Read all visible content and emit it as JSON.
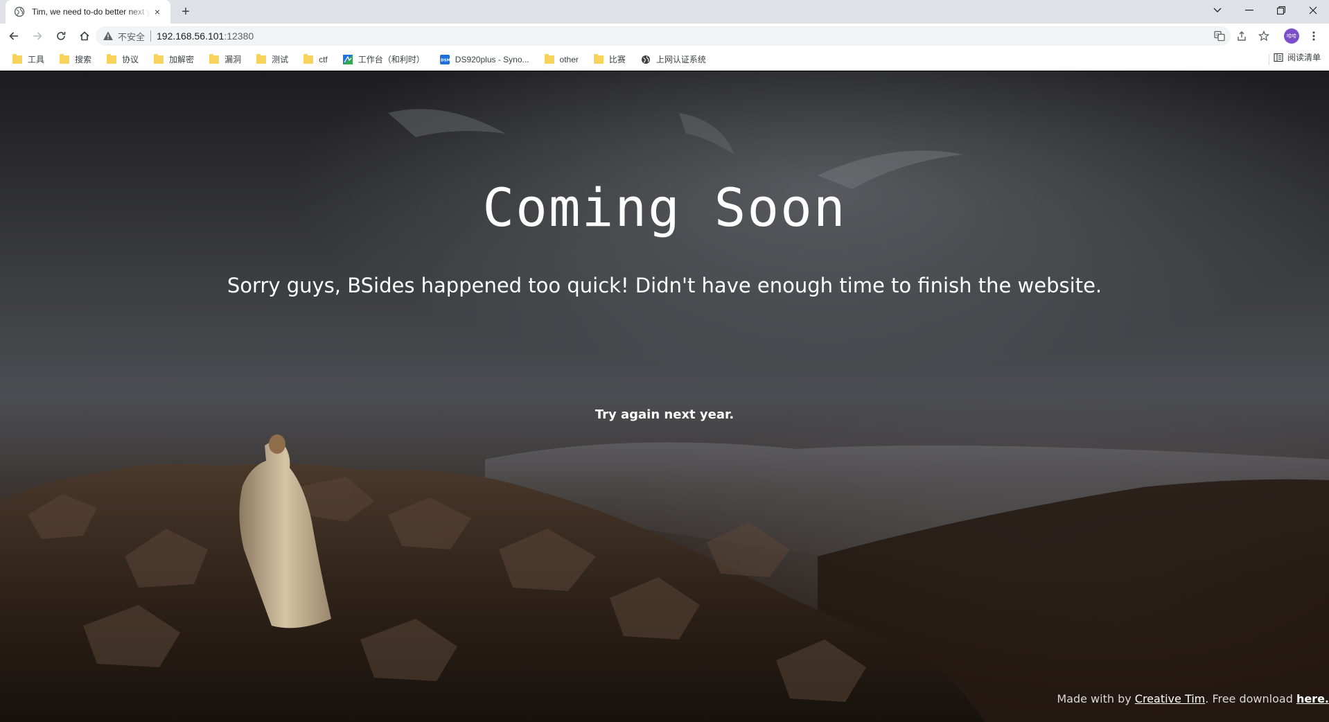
{
  "browser": {
    "tab": {
      "title": "Tim, we need to-do better next year for Initech",
      "close": "×"
    },
    "new_tab": "+",
    "window_controls": {
      "menu": "⌄",
      "minimize": "—",
      "restore": "❐",
      "close": "✕"
    },
    "address": {
      "security_label": "不安全",
      "host": "192.168.56.101",
      "port": ":12380"
    },
    "profile_initials": "哈哈"
  },
  "bookmarks": {
    "items": [
      {
        "label": "工具",
        "icon": "folder-icon"
      },
      {
        "label": "搜索",
        "icon": "folder-icon"
      },
      {
        "label": "协议",
        "icon": "folder-icon"
      },
      {
        "label": "加解密",
        "icon": "folder-icon"
      },
      {
        "label": "漏洞",
        "icon": "folder-icon"
      },
      {
        "label": "测试",
        "icon": "folder-icon"
      },
      {
        "label": "ctf",
        "icon": "folder-icon"
      },
      {
        "label": "工作台（和利时）",
        "icon": "site-icon"
      },
      {
        "label": "DS920plus - Syno...",
        "icon": "dsm-icon"
      },
      {
        "label": "other",
        "icon": "folder-icon"
      },
      {
        "label": "比赛",
        "icon": "folder-icon"
      },
      {
        "label": "上网认证系统",
        "icon": "globe-icon"
      }
    ],
    "reading_list": "阅读清单"
  },
  "page": {
    "heading": "Coming Soon",
    "subheading": "Sorry guys, BSides happened too quick! Didn't have enough time to finish the website.",
    "tagline": "Try again next year.",
    "footer": {
      "prefix": "Made with by ",
      "author_link": "Creative Tim",
      "middle": ". Free download ",
      "download_link": "here."
    }
  }
}
